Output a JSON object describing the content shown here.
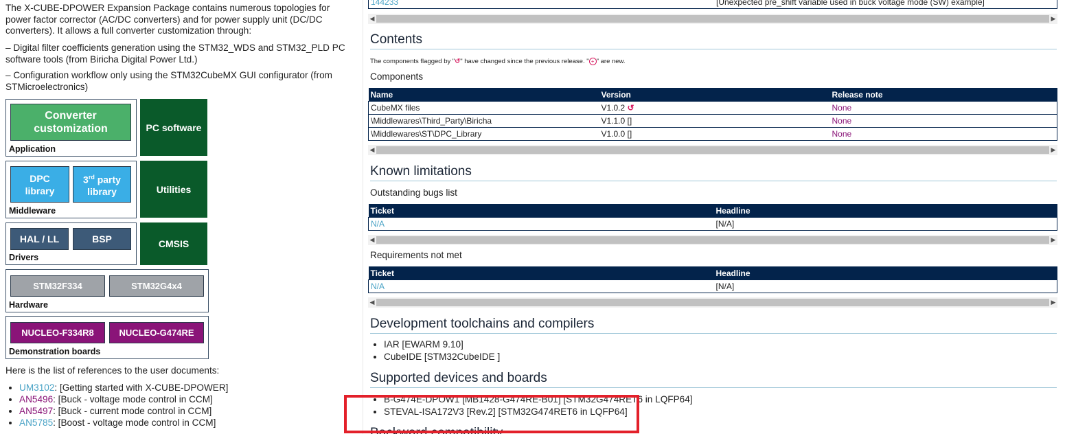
{
  "intro": {
    "p1": "The X-CUBE-DPOWER Expansion Package contains numerous topologies for power factor corrector (AC/DC converters) and for power supply unit (DC/DC converters). It allows a full converter customization through:",
    "p2": "– Digital filter coefficients generation using the STM32_WDS and STM32_PLD PC software tools (from Biricha Digital Power Ltd.)",
    "p3": "– Configuration workflow only using the STM32CubeMX GUI configurator (from STMicroelectronics)"
  },
  "diagram": {
    "application": {
      "label": "Application",
      "box": "Converter customization"
    },
    "pc_software": "PC software",
    "middleware": {
      "label": "Middleware",
      "dpc": "DPC library",
      "third_party": "3rd party library"
    },
    "utilities": "Utilities",
    "drivers": {
      "label": "Drivers",
      "hal": "HAL / LL",
      "bsp": "BSP"
    },
    "cmsis": "CMSIS",
    "hardware": {
      "label": "Hardware",
      "a": "STM32F334",
      "b": "STM32G4x4"
    },
    "demo": {
      "label": "Demonstration boards",
      "a": "NUCLEO-F334R8",
      "b": "NUCLEO-G474RE"
    }
  },
  "references": {
    "intro": "Here is the list of references to the user documents:",
    "items": [
      {
        "id": "UM3102",
        "text": ": [Getting started with X-CUBE-DPOWER]"
      },
      {
        "id": "AN5496",
        "text": ": [Buck - voltage mode control in CCM]"
      },
      {
        "id": "AN5497",
        "text": ": [Buck - current mode control in CCM]"
      },
      {
        "id": "AN5785",
        "text": ": [Boost - voltage mode control in CCM]"
      }
    ]
  },
  "top_row": {
    "ticket": "144233",
    "headline": "[Unexpected pre_shift variable used in buck voltage mode (SW) example]"
  },
  "contents": {
    "title": "Contents",
    "note_pre": "The components flagged by \"",
    "note_mid": "\" have changed since the previous release. \"",
    "note_post": "\" are new.",
    "components_title": "Components",
    "columns": [
      "Name",
      "Version",
      "Release note"
    ],
    "rows": [
      {
        "name": "CubeMX files",
        "version": "V1.0.2",
        "changed": true,
        "note": "None"
      },
      {
        "name": "\\Middlewares\\Third_Party\\Biricha",
        "version": "V1.1.0 []",
        "changed": false,
        "note": "None"
      },
      {
        "name": "\\Middlewares\\ST\\DPC_Library",
        "version": "V1.0.0 []",
        "changed": false,
        "note": "None"
      }
    ]
  },
  "known_limitations": {
    "title": "Known limitations",
    "bugs_title": "Outstanding bugs list",
    "req_title": "Requirements not met",
    "columns": [
      "Ticket",
      "Headline"
    ],
    "bug_row": {
      "ticket": "N/A",
      "headline": "[N/A]"
    },
    "req_row": {
      "ticket": "N/A",
      "headline": "[N/A]"
    }
  },
  "toolchains": {
    "title": "Development toolchains and compilers",
    "items": [
      "IAR [EWARM 9.10]",
      "CubeIDE [STM32CubeIDE ]"
    ]
  },
  "devices": {
    "title": "Supported devices and boards",
    "items": [
      "B-G474E-DPOW1 [MB1428-G474RE-B01] [STM32G474RET6 in LQFP64]",
      "STEVAL-ISA172V3 [Rev.2] [STM32G474RET6 in LQFP64]"
    ]
  },
  "backward": {
    "title": "Backward compatibility"
  },
  "colors": {
    "highlight": "#e3202a",
    "header": "#03234b",
    "link": "#4aa3c6",
    "release_link": "#8a1478"
  }
}
